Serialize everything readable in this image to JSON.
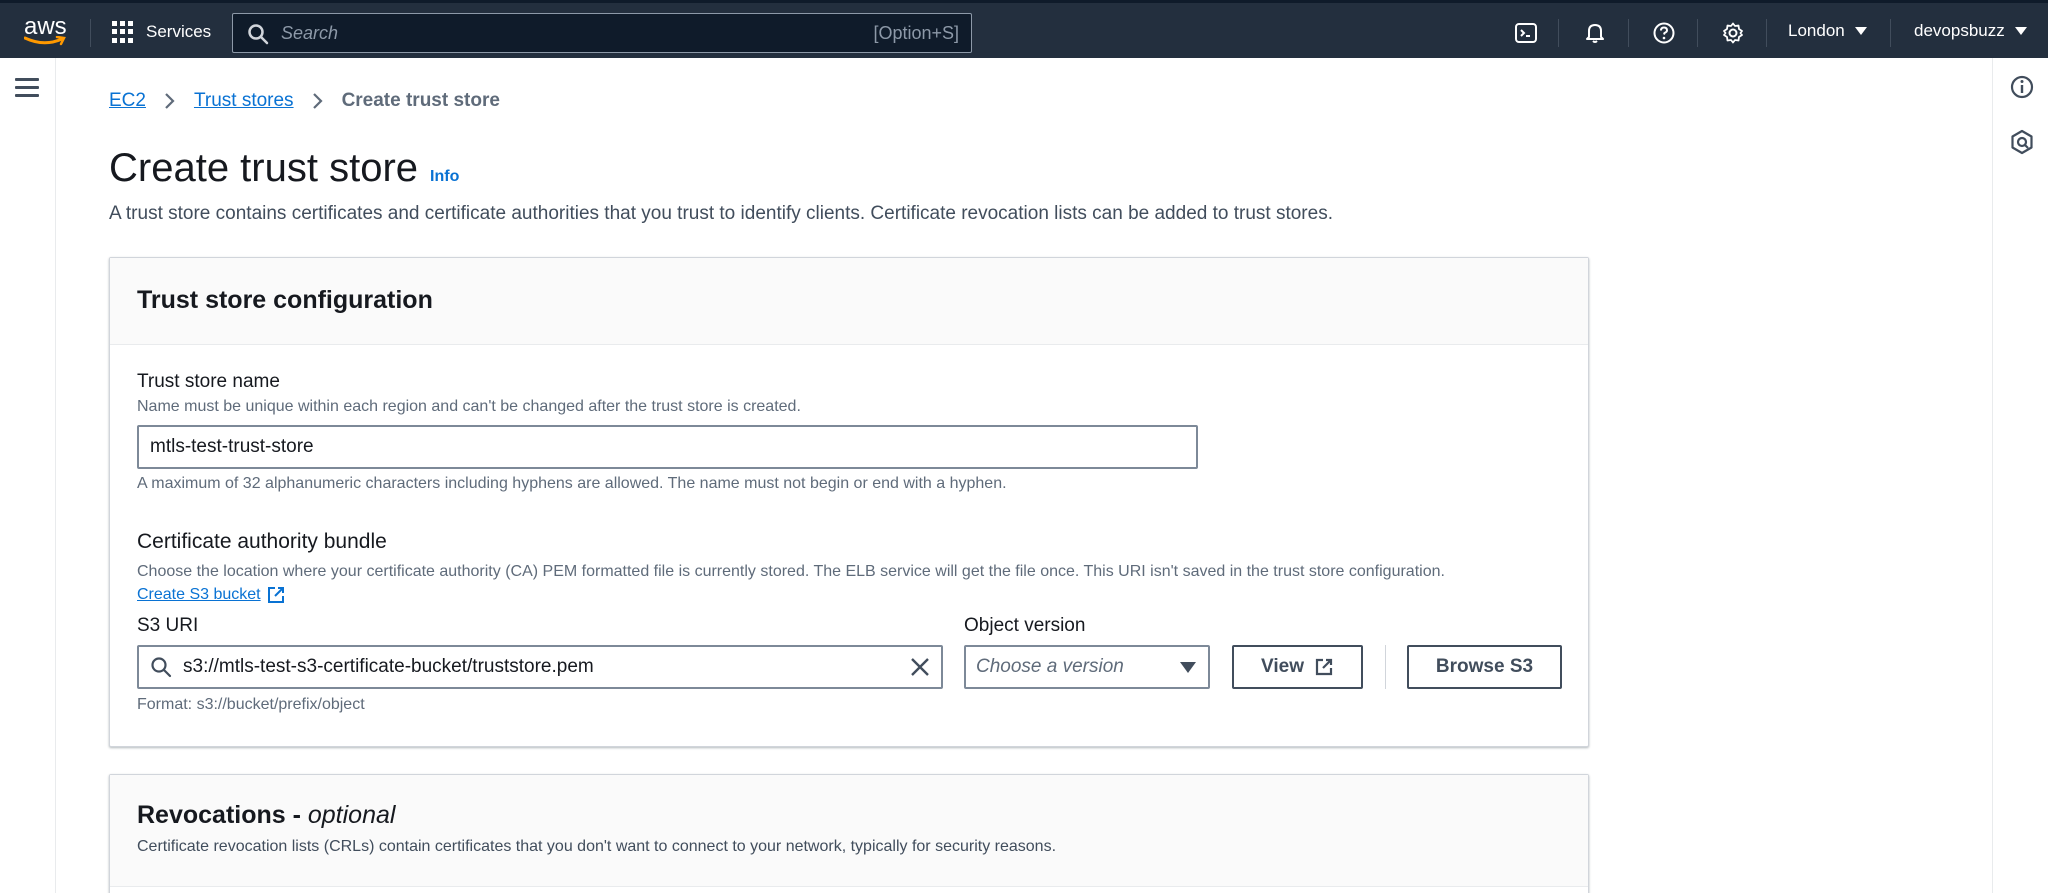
{
  "topnav": {
    "logo_text": "aws",
    "services_label": "Services",
    "search_placeholder": "Search",
    "search_shortcut": "[Option+S]",
    "region_label": "London",
    "account_label": "devopsbuzz",
    "icons": [
      "cloudshell-icon",
      "bell-icon",
      "help-icon",
      "settings-icon"
    ]
  },
  "breadcrumb": {
    "items": [
      "EC2",
      "Trust stores"
    ],
    "current": "Create trust store"
  },
  "page": {
    "title": "Create trust store",
    "info_label": "Info",
    "description": "A trust store contains certificates and certificate authorities that you trust to identify clients. Certificate revocation lists can be added to trust stores."
  },
  "config_panel": {
    "title": "Trust store configuration",
    "name_label": "Trust store name",
    "name_desc": "Name must be unique within each region and can't be changed after the trust store is created.",
    "name_value": "mtls-test-trust-store",
    "name_constraint": "A maximum of 32 alphanumeric characters including hyphens are allowed. The name must not begin or end with a hyphen.",
    "bundle_label": "Certificate authority bundle",
    "bundle_desc": "Choose the location where your certificate authority (CA) PEM formatted file is currently stored. The ELB service will get the file once. This URI isn't saved in the trust store configuration.",
    "create_bucket_link": "Create S3 bucket",
    "s3_uri_label": "S3 URI",
    "s3_uri_value": "s3://mtls-test-s3-certificate-bucket/truststore.pem",
    "s3_uri_format": "Format: s3://bucket/prefix/object",
    "object_version_label": "Object version",
    "object_version_placeholder": "Choose a version",
    "view_button": "View",
    "browse_button": "Browse S3"
  },
  "revocations_panel": {
    "title_main": "Revocations - ",
    "title_optional": "optional",
    "description": "Certificate revocation lists (CRLs) contain certificates that you don't want to connect to your network, typically for security reasons."
  },
  "colors": {
    "nav_bg": "#232f3e",
    "link": "#0972d3",
    "text": "#16191f",
    "muted": "#5f6b7a"
  }
}
